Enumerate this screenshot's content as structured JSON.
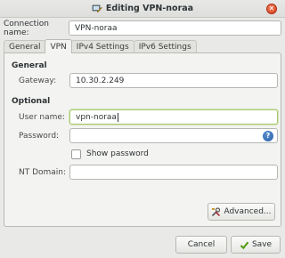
{
  "window": {
    "title": "Editing VPN-noraa",
    "close_glyph": "✕"
  },
  "connection_name": {
    "label": "Connection name:",
    "value": "VPN-noraa"
  },
  "tabs": [
    {
      "label": "General",
      "active": false
    },
    {
      "label": "VPN",
      "active": true
    },
    {
      "label": "IPv4 Settings",
      "active": false
    },
    {
      "label": "IPv6 Settings",
      "active": false
    }
  ],
  "vpn": {
    "general_heading": "General",
    "gateway_label": "Gateway:",
    "gateway_value": "10.30.2.249",
    "optional_heading": "Optional",
    "username_label": "User name:",
    "username_value": "vpn-noraa",
    "password_label": "Password:",
    "password_value": "",
    "help_glyph": "?",
    "show_password_label": "Show password",
    "show_password_checked": false,
    "nt_domain_label": "NT Domain:",
    "nt_domain_value": "",
    "advanced_label": "Advanced..."
  },
  "buttons": {
    "cancel_label": "Cancel",
    "save_label": "Save"
  },
  "icons": {
    "title_icon": "network-editor-icon",
    "advanced_icon": "tools-icon",
    "save_icon": "checkmark-icon",
    "help_icon": "help-icon"
  },
  "colors": {
    "focus_border": "#a7c772",
    "close_button": "#d63c18",
    "help_icon": "#2a5fa8",
    "save_check": "#4e9a06"
  }
}
